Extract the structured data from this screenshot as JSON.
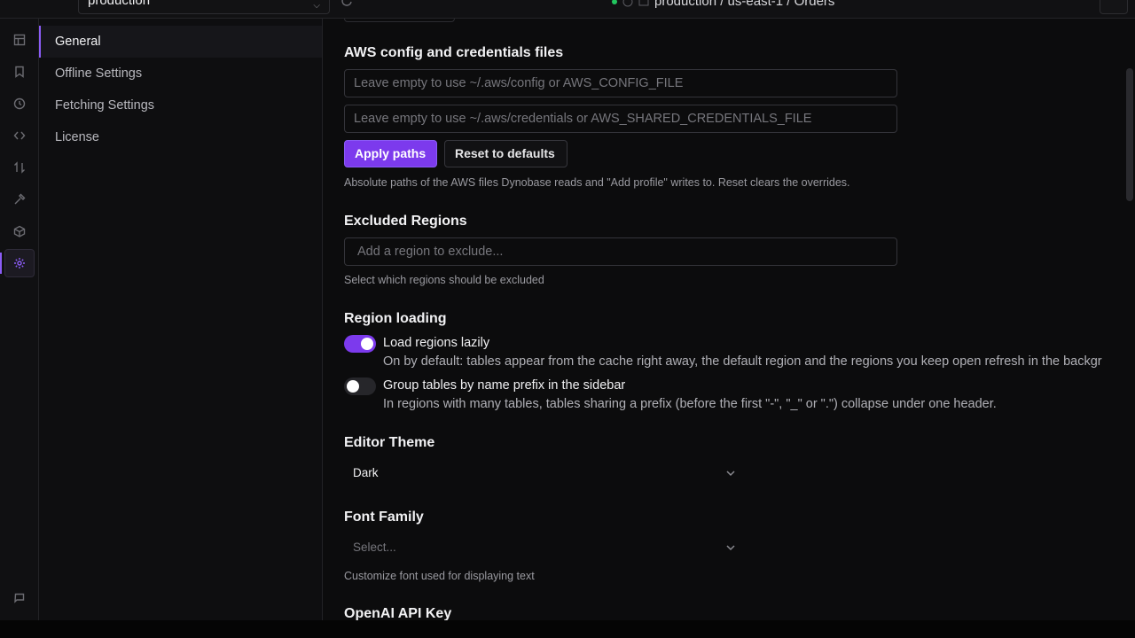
{
  "topbar": {
    "profile_value": "production",
    "breadcrumb": "production / us-east-1 / Orders"
  },
  "nav": {
    "items": [
      {
        "label": "General"
      },
      {
        "label": "Offline Settings"
      },
      {
        "label": "Fetching Settings"
      },
      {
        "label": "License"
      }
    ],
    "active": "General"
  },
  "aws_files": {
    "title": "AWS config and credentials files",
    "config_placeholder": "Leave empty to use ~/.aws/config or AWS_CONFIG_FILE",
    "credentials_placeholder": "Leave empty to use ~/.aws/credentials or AWS_SHARED_CREDENTIALS_FILE",
    "apply_label": "Apply paths",
    "reset_label": "Reset to defaults",
    "help": "Absolute paths of the AWS files Dynobase reads and \"Add profile\" writes to. Reset clears the overrides."
  },
  "excluded_regions": {
    "title": "Excluded Regions",
    "placeholder": "Add a region to exclude...",
    "help": "Select which regions should be excluded"
  },
  "region_loading": {
    "title": "Region loading",
    "lazy": {
      "label": "Load regions lazily",
      "desc": "On by default: tables appear from the cache right away, the default region and the regions you keep open refresh in the backgr",
      "enabled": true
    },
    "group": {
      "label": "Group tables by name prefix in the sidebar",
      "desc": "In regions with many tables, tables sharing a prefix (before the first \"-\", \"_\" or \".\") collapse under one header.",
      "enabled": false
    }
  },
  "editor_theme": {
    "title": "Editor Theme",
    "value": "Dark"
  },
  "font_family": {
    "title": "Font Family",
    "placeholder": "Select...",
    "help": "Customize font used for displaying text"
  },
  "openai": {
    "title": "OpenAI API Key"
  },
  "colors": {
    "accent": "#7c3aed",
    "status_dot": "#22c55e"
  }
}
